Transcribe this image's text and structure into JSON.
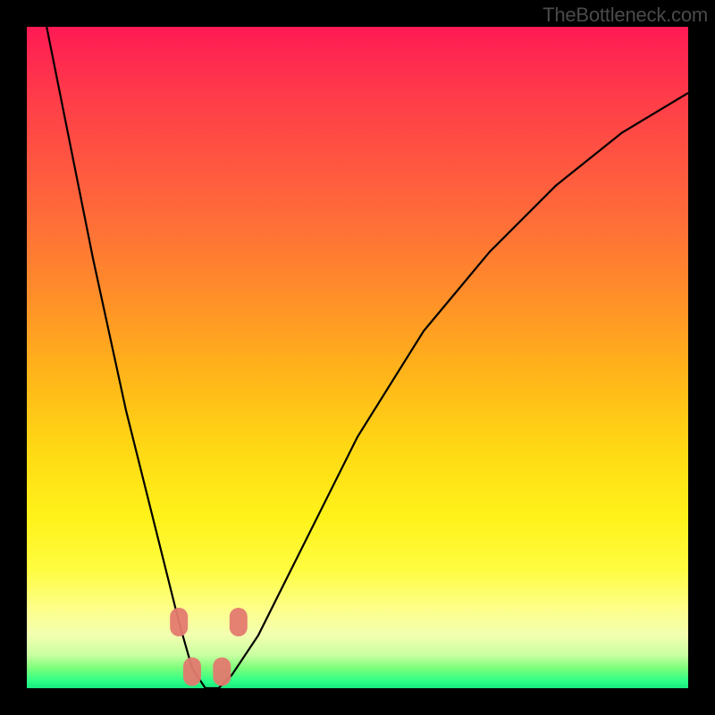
{
  "watermark": "TheBottleneck.com",
  "chart_data": {
    "type": "line",
    "title": "",
    "xlabel": "",
    "ylabel": "",
    "xlim": [
      0,
      100
    ],
    "ylim": [
      0,
      100
    ],
    "grid": false,
    "legend": false,
    "series": [
      {
        "name": "bottleneck-curve",
        "x": [
          3,
          10,
          15,
          20,
          23,
          25,
          27,
          29,
          31,
          35,
          40,
          50,
          60,
          70,
          80,
          90,
          100
        ],
        "values": [
          100,
          65,
          42,
          22,
          10,
          3,
          0,
          0,
          2,
          8,
          18,
          38,
          54,
          66,
          76,
          84,
          90
        ]
      }
    ],
    "annotations": [
      {
        "name": "left-band-upper",
        "x": 23.0,
        "y": 10.0
      },
      {
        "name": "left-band-lower",
        "x": 25.0,
        "y": 2.5
      },
      {
        "name": "right-band-lower",
        "x": 29.5,
        "y": 2.5
      },
      {
        "name": "right-band-upper",
        "x": 32.0,
        "y": 10.0
      }
    ],
    "colors": {
      "curve": "#000000",
      "annotation": "#e37a6f",
      "gradient_top": "#ff1a54",
      "gradient_mid": "#ffd914",
      "gradient_bottom": "#18e87e",
      "frame": "#000000"
    }
  }
}
